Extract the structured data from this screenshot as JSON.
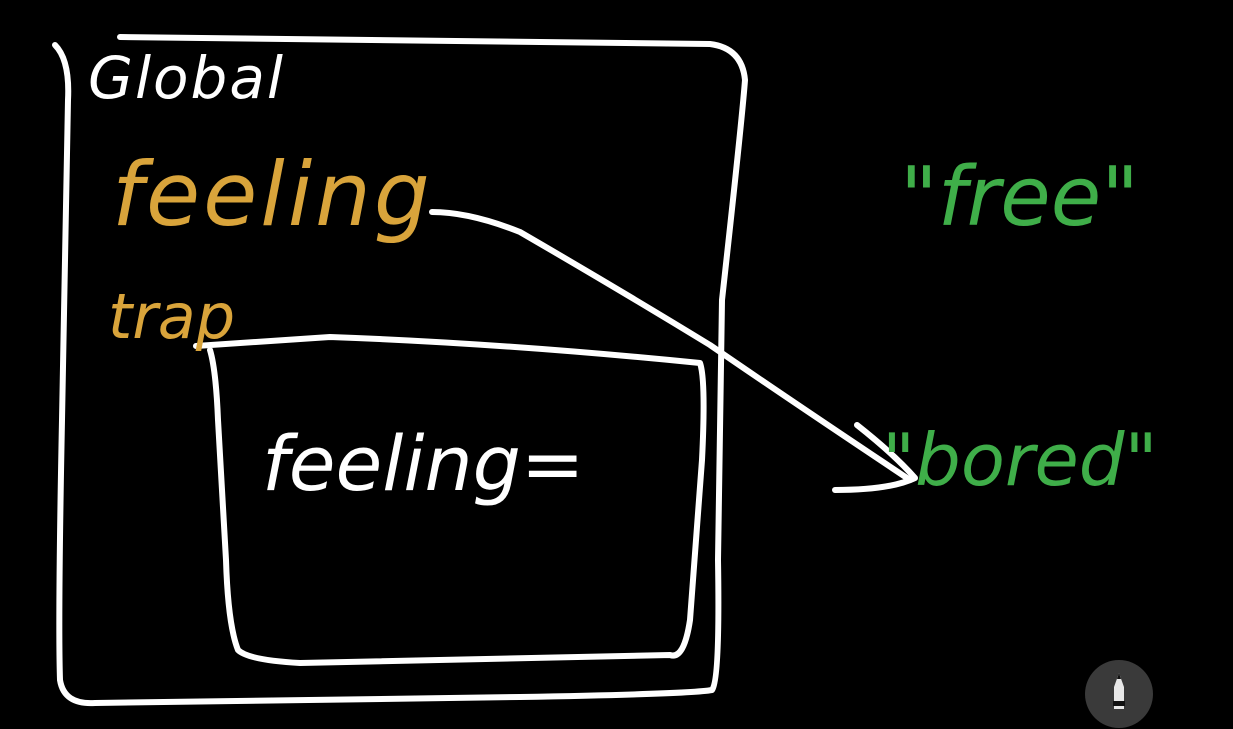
{
  "labels": {
    "global": "Global",
    "outer_var": "feeling",
    "function_name": "trap",
    "inner_assign": "feeling=",
    "value_free": "\"free\"",
    "value_bored": "\"bored\""
  },
  "colors": {
    "background": "#000000",
    "ink_white": "#ffffff",
    "ink_gold": "#d9a43b",
    "ink_green": "#3fae49",
    "button_bg": "#3a3a3a"
  },
  "tools": {
    "pencil_icon": "pencil-icon"
  }
}
